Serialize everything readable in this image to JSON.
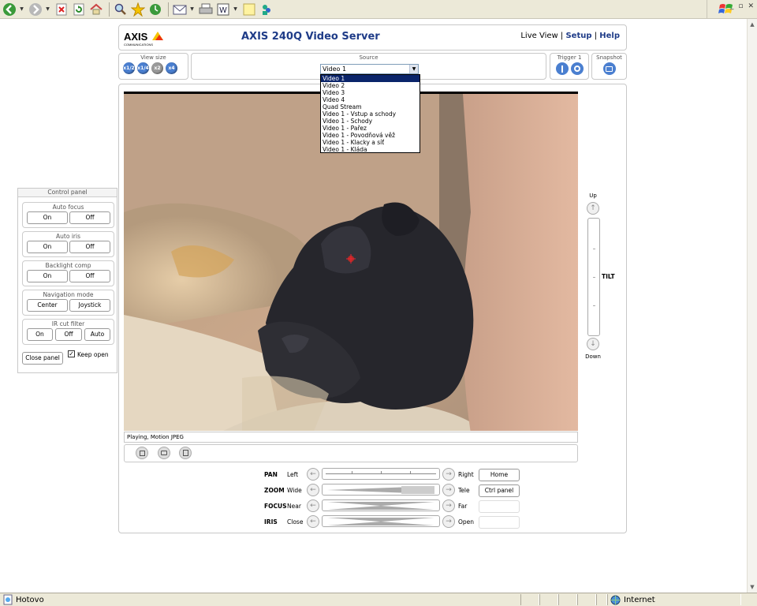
{
  "browser": {
    "toolbar_icons": [
      "back-icon",
      "forward-icon",
      "stop-icon",
      "refresh-icon",
      "home-icon",
      "search-icon",
      "favorites-icon",
      "history-icon",
      "mail-icon",
      "print-icon",
      "edit-icon",
      "discuss-icon",
      "messenger-icon"
    ],
    "status_text": "Hotovo",
    "zone_text": "Internet"
  },
  "header": {
    "logo": "AXIS",
    "logo_sub": "COMMUNICATIONS",
    "title": "AXIS 240Q Video Server",
    "nav": {
      "live": "Live View",
      "sep": "|",
      "setup": "Setup",
      "help": "Help"
    }
  },
  "top": {
    "view_size_label": "View size",
    "view_size_buttons": [
      "x1/2",
      "x1/4",
      "x2",
      "x4"
    ],
    "source_label": "Source",
    "source_value": "Video 1",
    "source_options": [
      "Video 1",
      "Video 2",
      "Video 3",
      "Video 4",
      "Quad Stream",
      "Video 1 - Vstup a schody",
      "Video 1 - Schody",
      "Video 1 - Pařez",
      "Video 1 - Povodňová věž",
      "Video 1 - Klacky a síť",
      "Video 1 - Kláda"
    ],
    "trigger_label": "Trigger 1",
    "snapshot_label": "Snapshot"
  },
  "video": {
    "status": "Playing, Motion JPEG"
  },
  "tilt": {
    "up": "Up",
    "label": "TILT",
    "down": "Down"
  },
  "ptz": {
    "pan": {
      "label": "PAN",
      "left": "Left",
      "right": "Right",
      "button": "Home"
    },
    "zoom": {
      "label": "ZOOM",
      "left": "Wide",
      "right": "Tele",
      "button": "Ctrl panel"
    },
    "focus": {
      "label": "FOCUS",
      "left": "Near",
      "right": "Far"
    },
    "iris": {
      "label": "IRIS",
      "left": "Close",
      "right": "Open"
    }
  },
  "control_panel": {
    "title": "Control panel",
    "groups": [
      {
        "title": "Auto focus",
        "buttons": [
          "On",
          "Off"
        ]
      },
      {
        "title": "Auto iris",
        "buttons": [
          "On",
          "Off"
        ]
      },
      {
        "title": "Backlight comp",
        "buttons": [
          "On",
          "Off"
        ]
      },
      {
        "title": "Navigation mode",
        "buttons": [
          "Center",
          "Joystick"
        ]
      },
      {
        "title": "IR cut filter",
        "buttons": [
          "On",
          "Off",
          "Auto"
        ]
      }
    ],
    "close_label": "Close panel",
    "keep_open_label": "Keep open",
    "keep_open_checked": true
  }
}
